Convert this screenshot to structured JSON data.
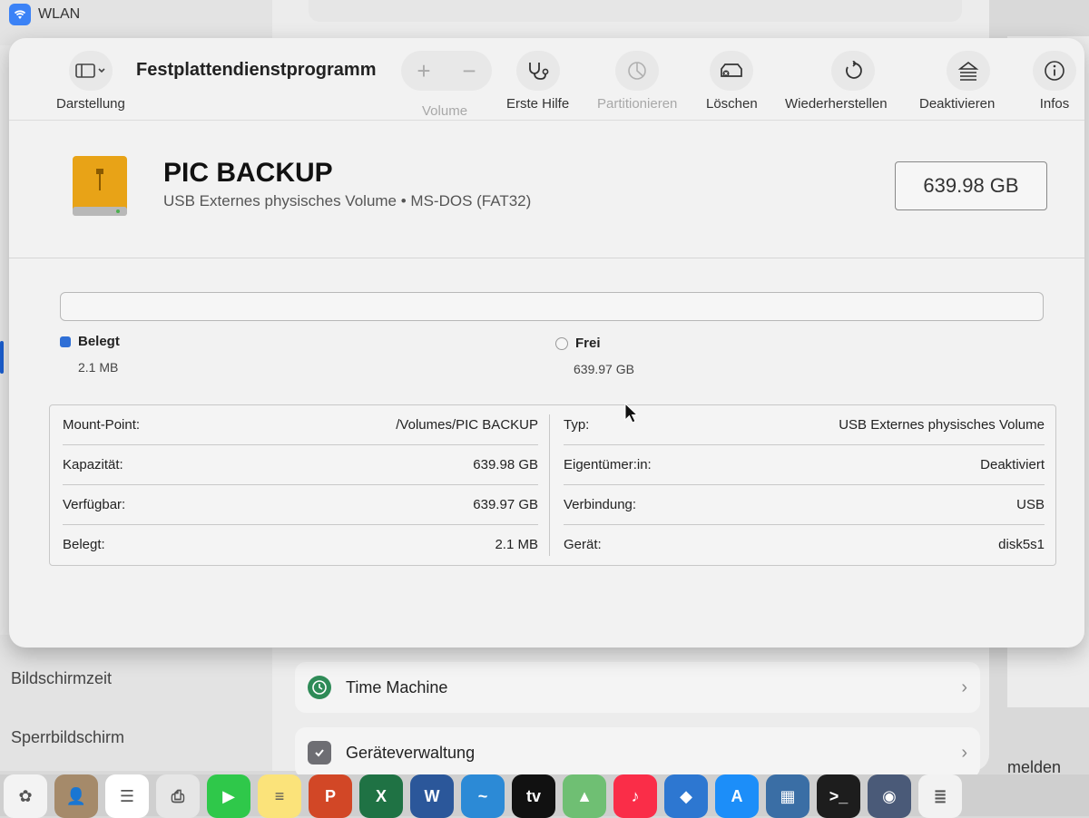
{
  "background": {
    "wlan_label": "WLAN",
    "sidebar_items": [
      "Bildschirmzeit",
      "Sperrbildschirm"
    ],
    "cards": [
      {
        "label": "Time Machine",
        "icon": "time-machine-icon"
      },
      {
        "label": "Geräteverwaltung",
        "icon": "checkmark-shield-icon"
      }
    ],
    "right_edge_text": "melden"
  },
  "toolbar": {
    "view_label": "Darstellung",
    "app_title": "Festplattendienstprogramm",
    "volume_label": "Volume",
    "first_aid_label": "Erste Hilfe",
    "partition_label": "Partitionieren",
    "erase_label": "Löschen",
    "restore_label": "Wiederherstellen",
    "unmount_label": "Deaktivieren",
    "info_label": "Infos"
  },
  "volume": {
    "name": "PIC BACKUP",
    "subtitle": "USB Externes physisches Volume • MS-DOS (FAT32)",
    "size": "639.98 GB",
    "icon": "external-drive-icon"
  },
  "usage": {
    "used_fraction": 3e-06,
    "used_label": "Belegt",
    "used_value": "2.1 MB",
    "used_color": "#2f6fd6",
    "free_label": "Frei",
    "free_value": "639.97 GB"
  },
  "info": {
    "left": [
      {
        "key": "Mount-Point:",
        "value": "/Volumes/PIC BACKUP"
      },
      {
        "key": "Kapazität:",
        "value": "639.98 GB"
      },
      {
        "key": "Verfügbar:",
        "value": "639.97 GB"
      },
      {
        "key": "Belegt:",
        "value": "2.1 MB"
      }
    ],
    "right": [
      {
        "key": "Typ:",
        "value": "USB Externes physisches Volume"
      },
      {
        "key": "Eigentümer:in:",
        "value": "Deaktiviert"
      },
      {
        "key": "Verbindung:",
        "value": "USB"
      },
      {
        "key": "Gerät:",
        "value": "disk5s1"
      }
    ]
  },
  "dock": {
    "apps": [
      {
        "name": "photos",
        "color": "#f3f3f3",
        "glyph": "✿"
      },
      {
        "name": "contacts",
        "color": "#a58a6a",
        "glyph": "👤"
      },
      {
        "name": "reminders",
        "color": "#ffffff",
        "glyph": "☰"
      },
      {
        "name": "printer",
        "color": "#e6e6e6",
        "glyph": "⎙"
      },
      {
        "name": "facetime",
        "color": "#2fc84a",
        "glyph": "▶"
      },
      {
        "name": "notes",
        "color": "#fbe37a",
        "glyph": "≡"
      },
      {
        "name": "powerpoint",
        "color": "#d24726",
        "glyph": "P"
      },
      {
        "name": "excel",
        "color": "#1f7244",
        "glyph": "X"
      },
      {
        "name": "word",
        "color": "#2b579a",
        "glyph": "W"
      },
      {
        "name": "freeform",
        "color": "#2c8ad6",
        "glyph": "~"
      },
      {
        "name": "apple-tv",
        "color": "#111111",
        "glyph": "tv"
      },
      {
        "name": "maps",
        "color": "#6fbf73",
        "glyph": "▲"
      },
      {
        "name": "music",
        "color": "#fa2d48",
        "glyph": "♪"
      },
      {
        "name": "keynote",
        "color": "#2d77d1",
        "glyph": "◆"
      },
      {
        "name": "app-store",
        "color": "#1c8ef9",
        "glyph": "A"
      },
      {
        "name": "calculator",
        "color": "#3a6ea5",
        "glyph": "▦"
      },
      {
        "name": "terminal",
        "color": "#1d1d1d",
        "glyph": ">_"
      },
      {
        "name": "disk-utility",
        "color": "#4a5a78",
        "glyph": "◉"
      },
      {
        "name": "textedit",
        "color": "#f2f2f2",
        "glyph": "≣"
      }
    ]
  }
}
